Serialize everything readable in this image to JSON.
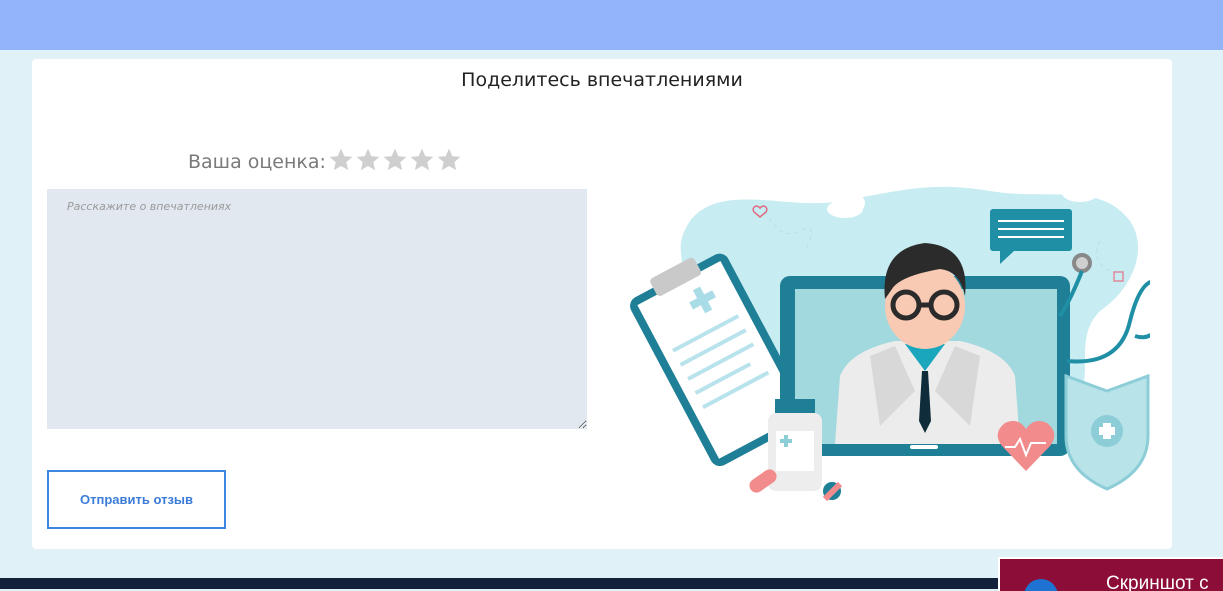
{
  "header": {
    "color": "#93b4f8"
  },
  "feedback": {
    "title": "Поделитесь впечатлениями",
    "rating_label": "Ваша оценка:",
    "star_count": 5,
    "selected_rating": 0,
    "review_placeholder": "Расскажите о впечатлениях",
    "review_value": "",
    "submit_label": "Отправить отзыв"
  },
  "illustration": {
    "subject": "doctor-video-consultation",
    "icons": [
      "laptop-icon",
      "doctor-icon",
      "clipboard-icon",
      "stethoscope-icon",
      "shield-plus-icon",
      "heart-icon",
      "pill-bottle-icon",
      "chat-bubble-icon"
    ]
  },
  "popup": {
    "text": "Скриншот с"
  },
  "colors": {
    "accent": "#3f86e0",
    "card": "#ffffff",
    "page": "#e0f1f7",
    "footer": "#14213a",
    "popup": "#8b0d38"
  }
}
